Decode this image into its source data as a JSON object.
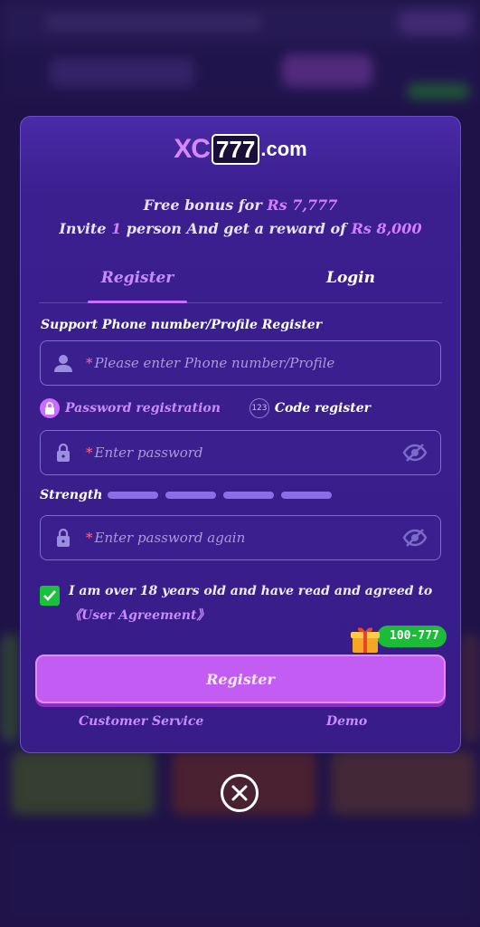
{
  "logo": {
    "xc": "XC",
    "num": "777",
    "domain": ".com"
  },
  "promo": {
    "line1_prefix": "Free bonus for ",
    "line1_amount": "Rs 7,777",
    "line2_prefix": "Invite ",
    "line2_count": "1",
    "line2_mid": " person And get a reward of ",
    "line2_amount": "Rs 8,000"
  },
  "tabs": [
    {
      "label": "Register",
      "active": true
    },
    {
      "label": "Login",
      "active": false
    }
  ],
  "form": {
    "section_label": "Support Phone number/Profile Register",
    "phone_placeholder": "Please enter Phone number/Profile",
    "required_mark": "*",
    "modes": [
      {
        "label": "Password registration",
        "selected": true
      },
      {
        "label": "Code register",
        "icon_text": "123",
        "selected": false
      }
    ],
    "password_placeholder": "Enter password",
    "strength_label": "Strength",
    "strength_levels": 4,
    "password_again_placeholder": "Enter password again",
    "agree_text": "I am over 18 years old and have read and agreed to",
    "agreement_link": "《User Agreement》",
    "agree_checked": true
  },
  "badge": {
    "text": "100-777"
  },
  "register_button": "Register",
  "links": {
    "customer_service": "Customer Service",
    "demo": "Demo"
  },
  "colors": {
    "accent": "#c96cff",
    "modal_bg": "#381c88",
    "button": "#c35cf2",
    "check": "#19c23a"
  },
  "icons": [
    "user-icon",
    "lock-icon",
    "eye-off-icon",
    "gift-icon",
    "close-icon",
    "check-icon"
  ]
}
